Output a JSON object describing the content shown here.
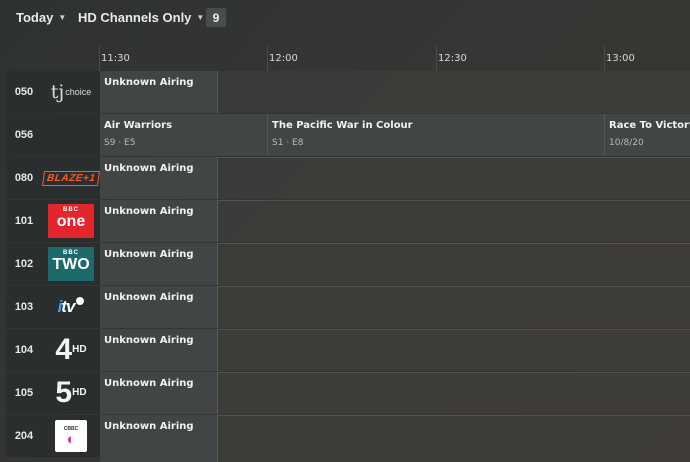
{
  "toolbar": {
    "day_label": "Today",
    "filter_label": "HD Channels Only",
    "count": "9"
  },
  "timeline": {
    "ticks": [
      "11:30",
      "12:00",
      "12:30",
      "13:00"
    ]
  },
  "channels": [
    {
      "number": "050",
      "logo": "tj-choice-logo",
      "logo_text": "choice",
      "programs": [
        {
          "title": "Unknown Airing",
          "sub": ""
        }
      ]
    },
    {
      "number": "056",
      "logo": "sun-logo",
      "programs": [
        {
          "title": "Air Warriors",
          "sub": "S9 · E5"
        },
        {
          "title": "The Pacific War in Colour",
          "sub": "S1 · E8"
        },
        {
          "title": "Race To Victory",
          "sub": "10/8/20"
        }
      ]
    },
    {
      "number": "080",
      "logo": "blaze-plus1-logo",
      "logo_text": "BLAZE+1",
      "programs": [
        {
          "title": "Unknown Airing",
          "sub": ""
        }
      ]
    },
    {
      "number": "101",
      "logo": "bbc-one-hd-logo",
      "logo_text": "one",
      "programs": [
        {
          "title": "Unknown Airing",
          "sub": ""
        }
      ]
    },
    {
      "number": "102",
      "logo": "bbc-two-hd-logo",
      "logo_text": "TWO",
      "programs": [
        {
          "title": "Unknown Airing",
          "sub": ""
        }
      ]
    },
    {
      "number": "103",
      "logo": "itv-hd-logo",
      "programs": [
        {
          "title": "Unknown Airing",
          "sub": ""
        }
      ]
    },
    {
      "number": "104",
      "logo": "channel-4-hd-logo",
      "programs": [
        {
          "title": "Unknown Airing",
          "sub": ""
        }
      ]
    },
    {
      "number": "105",
      "logo": "channel-5-hd-logo",
      "programs": [
        {
          "title": "Unknown Airing",
          "sub": ""
        }
      ]
    },
    {
      "number": "204",
      "logo": "cbbc-hd-logo",
      "programs": [
        {
          "title": "Unknown Airing",
          "sub": ""
        }
      ]
    }
  ],
  "colors": {
    "background": "#343533",
    "cell_first": "#414545",
    "blaze": "#ff5a1f",
    "bbc_one": "#e3262d",
    "bbc_two": "#1d6a6d"
  }
}
